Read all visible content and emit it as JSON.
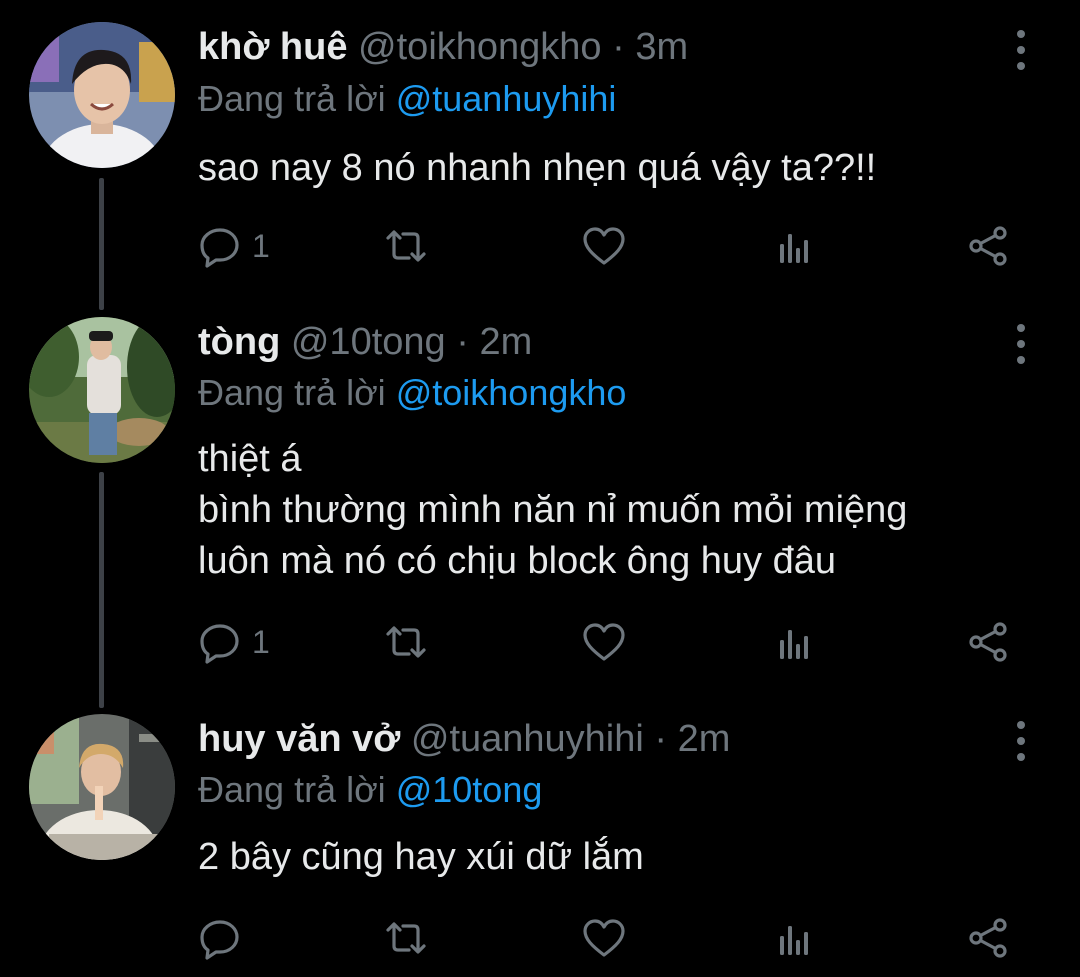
{
  "reply_prefix": "Đang trả lời",
  "colors": {
    "background": "#000000",
    "text": "#e7e9ea",
    "muted": "#6e767d",
    "link": "#1d9bf0",
    "thread_line": "#3d4147"
  },
  "tweets": [
    {
      "display_name": "khờ huê",
      "handle": "@toikhongkho",
      "separator": "·",
      "time": "3m",
      "replying_to": "@tuanhuyhihi",
      "lines": [
        "sao nay 8 nó nhanh nhẹn quá vậy ta??!!"
      ],
      "reply_count": "1",
      "icons": [
        "reply-icon",
        "retweet-icon",
        "like-icon",
        "analytics-icon",
        "share-icon",
        "more-icon"
      ]
    },
    {
      "display_name": "tòng",
      "handle": "@10tong",
      "separator": "·",
      "time": "2m",
      "replying_to": "@toikhongkho",
      "lines": [
        "thiệt á",
        "bình thường mình năn nỉ muốn mỏi miệng",
        "luôn mà nó có chịu block ông huy đâu"
      ],
      "reply_count": "1",
      "icons": [
        "reply-icon",
        "retweet-icon",
        "like-icon",
        "analytics-icon",
        "share-icon",
        "more-icon"
      ]
    },
    {
      "display_name": "huy văn vở",
      "handle": "@tuanhuyhihi",
      "separator": "·",
      "time": "2m",
      "replying_to": "@10tong",
      "lines": [
        "2 bây cũng hay xúi dữ lắm"
      ],
      "reply_count": "",
      "icons": [
        "reply-icon",
        "retweet-icon",
        "like-icon",
        "analytics-icon",
        "share-icon",
        "more-icon"
      ]
    }
  ]
}
